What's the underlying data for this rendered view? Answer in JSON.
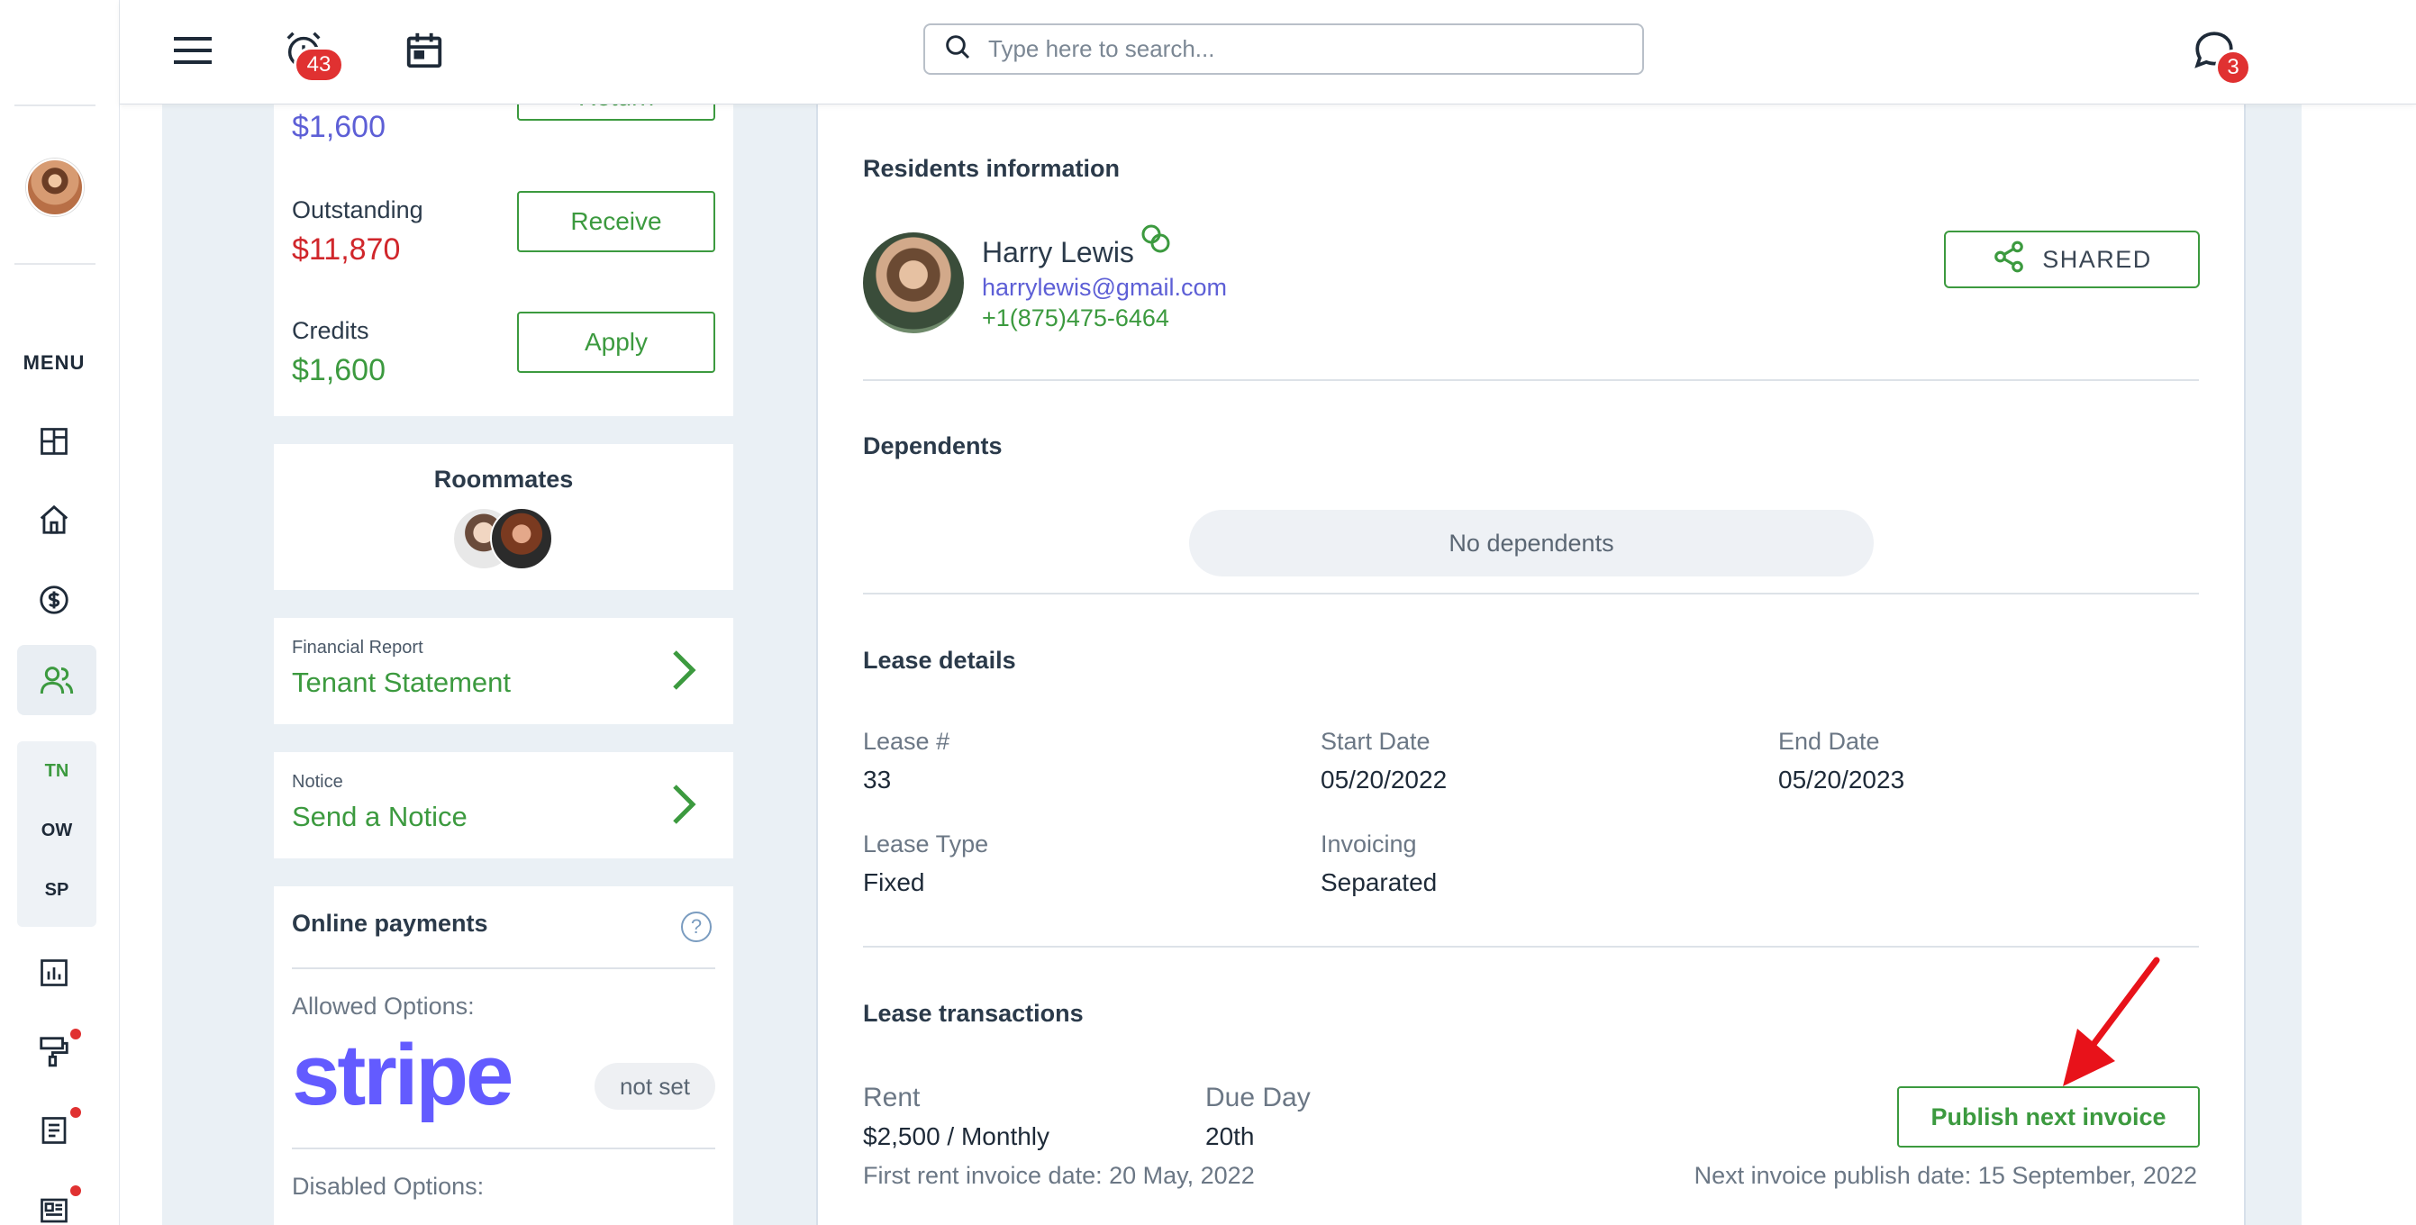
{
  "topbar": {
    "alarm_badge": "43",
    "search_placeholder": "Type here to search...",
    "chat_badge": "3"
  },
  "sidebar": {
    "menu_label": "MENU",
    "sub_items": [
      "TN",
      "OW",
      "SP"
    ]
  },
  "finance": {
    "return_label": "Return",
    "return_amount": "$1,600",
    "outstanding_label": "Outstanding",
    "outstanding_amount": "$11,870",
    "receive_label": "Receive",
    "credits_label": "Credits",
    "credits_amount": "$1,600",
    "apply_label": "Apply"
  },
  "roommates": {
    "title": "Roommates"
  },
  "financial_report": {
    "small": "Financial Report",
    "large": "Tenant Statement"
  },
  "notice": {
    "small": "Notice",
    "large": "Send a Notice"
  },
  "online_payments": {
    "title": "Online payments",
    "allowed_label": "Allowed Options:",
    "stripe_logo": "stripe",
    "not_set": "not set",
    "disabled_label": "Disabled Options:"
  },
  "residents": {
    "title": "Residents information",
    "name": "Harry Lewis",
    "email": "harrylewis@gmail.com",
    "phone": "+1(875)475-6464",
    "shared_label": "SHARED"
  },
  "dependents": {
    "title": "Dependents",
    "empty": "No dependents"
  },
  "lease": {
    "title": "Lease details",
    "lease_no_label": "Lease #",
    "lease_no": "33",
    "start_label": "Start Date",
    "start": "05/20/2022",
    "end_label": "End Date",
    "end": "05/20/2023",
    "type_label": "Lease Type",
    "type": "Fixed",
    "invoicing_label": "Invoicing",
    "invoicing": "Separated"
  },
  "transactions": {
    "title": "Lease transactions",
    "rent_label": "Rent",
    "rent": "$2,500 / Monthly",
    "due_label": "Due Day",
    "due": "20th",
    "first_invoice": "First rent invoice date: 20 May, 2022",
    "publish_label": "Publish next invoice",
    "next_invoice": "Next invoice publish date: 15 September, 2022"
  },
  "colors": {
    "accent_green": "#3c9a3f",
    "debt_red": "#d0262b",
    "link_purple": "#5d5fd6",
    "annotation_arrow": "#e8121a"
  }
}
